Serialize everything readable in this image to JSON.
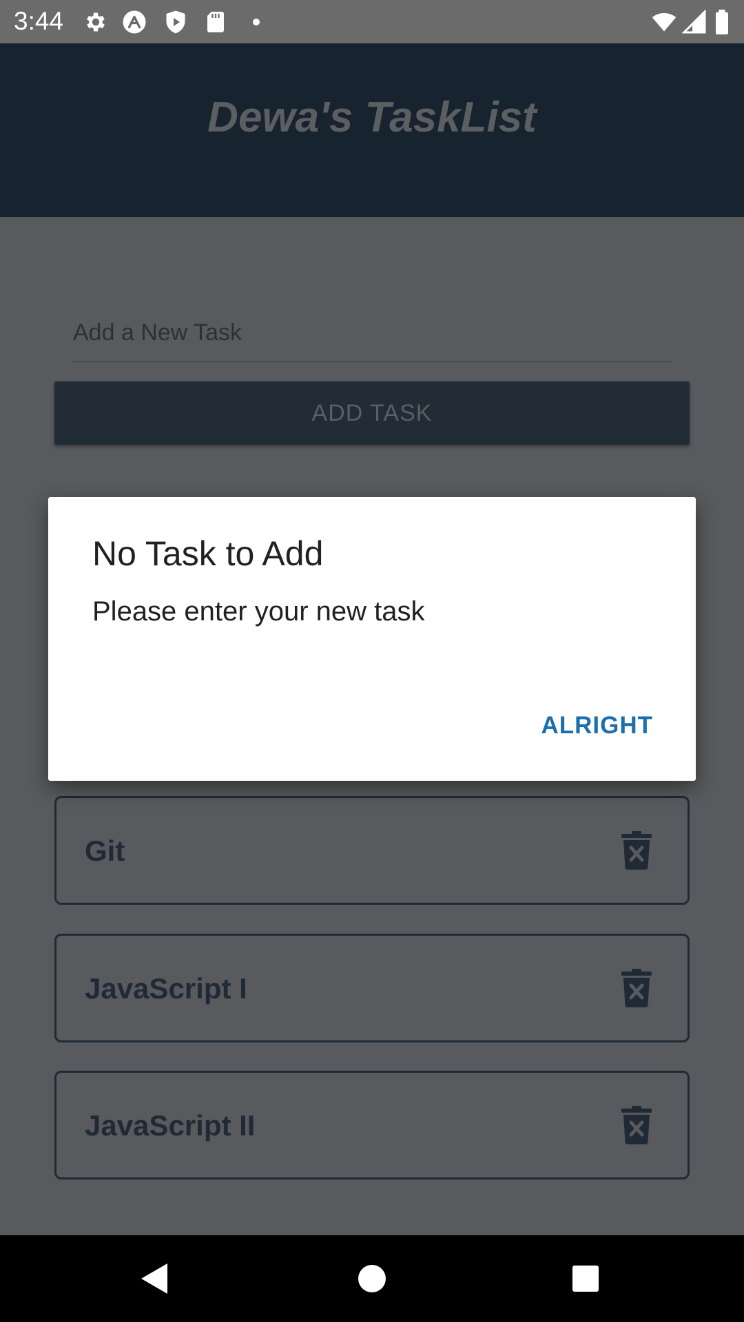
{
  "status_bar": {
    "time": "3:44",
    "icons_left": [
      "gear-icon",
      "app-a-icon",
      "shield-play-icon",
      "sd-card-icon",
      "dot-icon"
    ],
    "icons_right": [
      "wifi-icon",
      "signal-icon",
      "battery-icon"
    ]
  },
  "app": {
    "title": "Dewa's TaskList",
    "header_color": "#182330"
  },
  "form": {
    "input_placeholder": "Add a New Task",
    "input_value": "",
    "add_button_label": "ADD TASK"
  },
  "tasks": [
    {
      "label": "Git",
      "delete_icon": "trash-x-icon"
    },
    {
      "label": "JavaScript I",
      "delete_icon": "trash-x-icon"
    },
    {
      "label": "JavaScript II",
      "delete_icon": "trash-x-icon"
    }
  ],
  "dialog": {
    "title": "No Task to Add",
    "message": "Please enter your new task",
    "button_label": "ALRIGHT",
    "accent_color": "#1a6fb0"
  },
  "nav_bar": {
    "buttons": [
      "back-icon",
      "home-icon",
      "recents-icon"
    ]
  }
}
